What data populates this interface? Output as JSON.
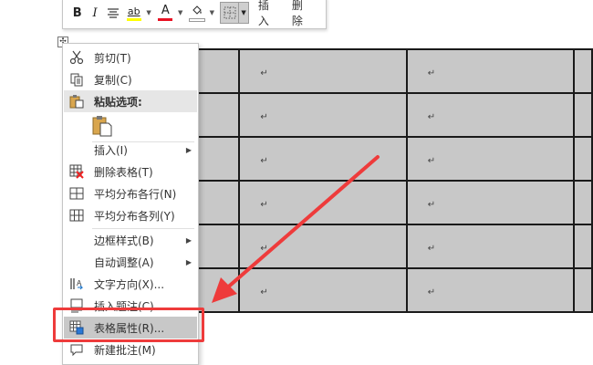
{
  "mini_toolbar": {
    "bold": "B",
    "italic": "I",
    "highlight": "ab",
    "font_color": "A",
    "insert_label": "插入",
    "delete_label": "删除",
    "highlight_color": "#ffff00",
    "font_color_value": "#e81123"
  },
  "table": {
    "paragraph_mark": "↵",
    "cell_color": "#c8c8c8"
  },
  "context_menu": {
    "items": [
      {
        "label": "剪切(T)",
        "icon": "scissors-icon"
      },
      {
        "label": "复制(C)",
        "icon": "copy-icon"
      },
      {
        "label": "粘贴选项:",
        "icon": "paste-icon"
      },
      {
        "label": "插入(I)",
        "icon": "",
        "submenu": true
      },
      {
        "label": "删除表格(T)",
        "icon": "delete-table-icon"
      },
      {
        "label": "平均分布各行(N)",
        "icon": "distribute-rows-icon"
      },
      {
        "label": "平均分布各列(Y)",
        "icon": "distribute-columns-icon"
      },
      {
        "label": "边框样式(B)",
        "icon": "",
        "submenu": true
      },
      {
        "label": "自动调整(A)",
        "icon": "",
        "submenu": true
      },
      {
        "label": "文字方向(X)...",
        "icon": "text-direction-icon"
      },
      {
        "label": "插入题注(C)...",
        "icon": "insert-caption-icon"
      },
      {
        "label": "表格属性(R)...",
        "icon": "table-properties-icon"
      },
      {
        "label": "新建批注(M)",
        "icon": "new-comment-icon"
      }
    ]
  },
  "annotation": {
    "color": "#ee3b3b"
  }
}
